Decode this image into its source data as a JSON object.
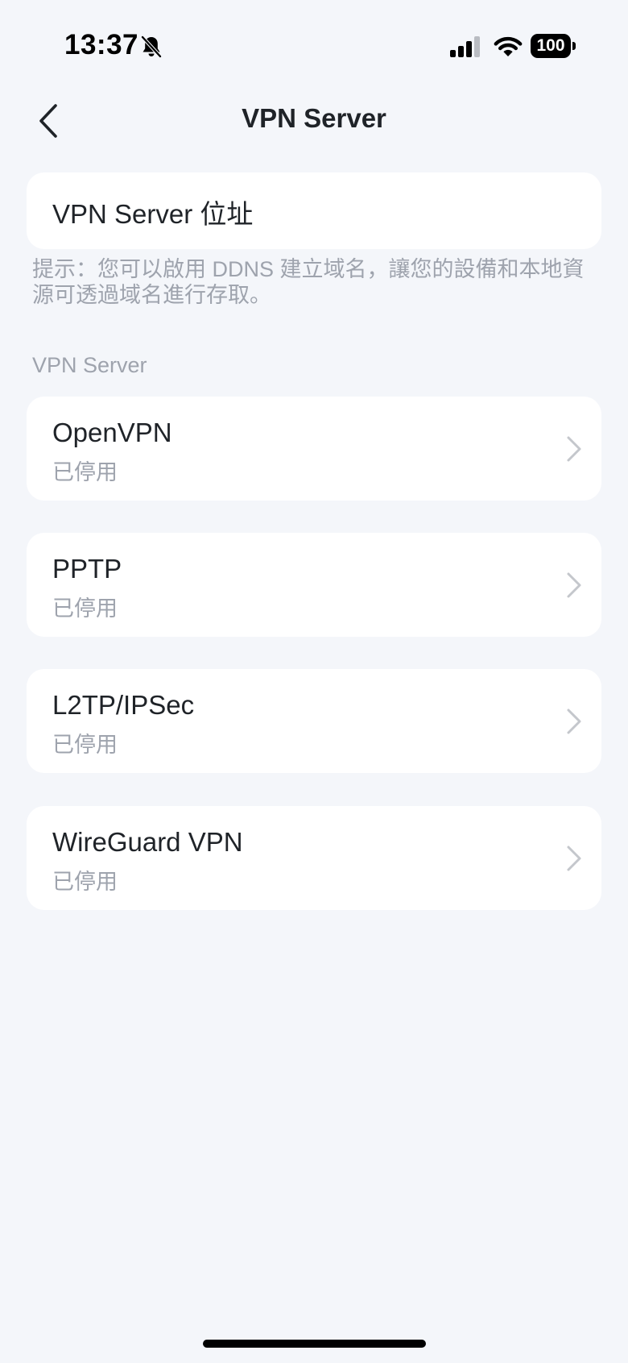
{
  "status_bar": {
    "time": "13:37",
    "battery": "100",
    "icons": [
      "bell-slash-icon",
      "cellular-signal-icon",
      "wifi-icon",
      "battery-icon"
    ]
  },
  "nav": {
    "title": "VPN Server",
    "back_icon": "chevron-left-icon"
  },
  "address": {
    "label": "VPN Server 位址"
  },
  "hint": "提示：您可以啟用 DDNS 建立域名，讓您的設備和本地資源可透過域名進行存取。",
  "section": {
    "title": "VPN Server",
    "items": [
      {
        "title": "OpenVPN",
        "status": "已停用"
      },
      {
        "title": "PPTP",
        "status": "已停用"
      },
      {
        "title": "L2TP/IPSec",
        "status": "已停用"
      },
      {
        "title": "WireGuard VPN",
        "status": "已停用"
      }
    ]
  },
  "colors": {
    "background": "#f4f6fa",
    "card": "#ffffff",
    "primary_text": "#1f2328",
    "secondary_text": "#9ea3ad",
    "chevron": "#c4c7cc"
  }
}
